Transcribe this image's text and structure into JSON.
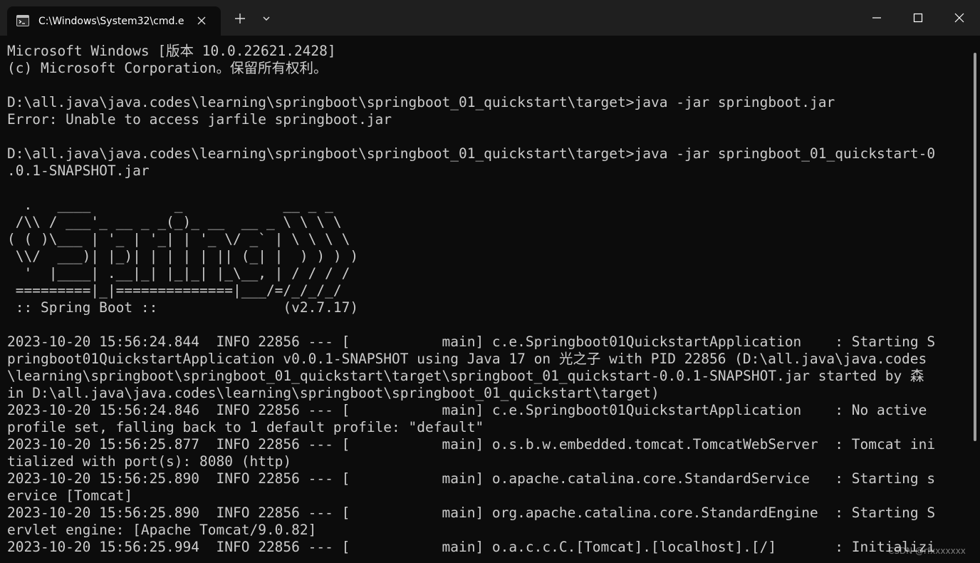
{
  "window": {
    "tab_title": "C:\\Windows\\System32\\cmd.e",
    "icons": {
      "tab": "cmd-console-icon",
      "tab_close": "close-icon",
      "new_tab": "plus-icon",
      "dropdown": "chevron-down-icon",
      "minimize": "minimize-icon",
      "maximize": "maximize-icon",
      "close": "close-icon"
    }
  },
  "colors": {
    "titlebar": "#1f1f1f",
    "terminal_bg": "#0c0c0c",
    "terminal_text": "#cccccc"
  },
  "terminal": {
    "lines": [
      "Microsoft Windows [版本 10.0.22621.2428]",
      "(c) Microsoft Corporation。保留所有权利。",
      "",
      "D:\\all.java\\java.codes\\learning\\springboot\\springboot_01_quickstart\\target>java -jar springboot.jar",
      "Error: Unable to access jarfile springboot.jar",
      "",
      "D:\\all.java\\java.codes\\learning\\springboot\\springboot_01_quickstart\\target>java -jar springboot_01_quickstart-0",
      ".0.1-SNAPSHOT.jar",
      "",
      "  .   ____          _            __ _ _",
      " /\\\\ / ___'_ __ _ _(_)_ __  __ _ \\ \\ \\ \\",
      "( ( )\\___ | '_ | '_| | '_ \\/ _` | \\ \\ \\ \\",
      " \\\\/  ___)| |_)| | | | | || (_| |  ) ) ) )",
      "  '  |____| .__|_| |_|_| |_\\__, | / / / /",
      " =========|_|==============|___/=/_/_/_/",
      " :: Spring Boot ::               (v2.7.17)",
      "",
      "2023-10-20 15:56:24.844  INFO 22856 --- [           main] c.e.Springboot01QuickstartApplication    : Starting S",
      "pringboot01QuickstartApplication v0.0.1-SNAPSHOT using Java 17 on 光之子 with PID 22856 (D:\\all.java\\java.codes",
      "\\learning\\springboot\\springboot_01_quickstart\\target\\springboot_01_quickstart-0.0.1-SNAPSHOT.jar started by 森",
      "in D:\\all.java\\java.codes\\learning\\springboot\\springboot_01_quickstart\\target)",
      "2023-10-20 15:56:24.846  INFO 22856 --- [           main] c.e.Springboot01QuickstartApplication    : No active",
      "profile set, falling back to 1 default profile: \"default\"",
      "2023-10-20 15:56:25.877  INFO 22856 --- [           main] o.s.b.w.embedded.tomcat.TomcatWebServer  : Tomcat ini",
      "tialized with port(s): 8080 (http)",
      "2023-10-20 15:56:25.890  INFO 22856 --- [           main] o.apache.catalina.core.StandardService   : Starting s",
      "ervice [Tomcat]",
      "2023-10-20 15:56:25.890  INFO 22856 --- [           main] org.apache.catalina.core.StandardEngine  : Starting S",
      "ervlet engine: [Apache Tomcat/9.0.82]",
      "2023-10-20 15:56:25.994  INFO 22856 --- [           main] o.a.c.c.C.[Tomcat].[localhost].[/]       : Initializi"
    ]
  },
  "watermark": "CSDN @rfxxxxxxx"
}
